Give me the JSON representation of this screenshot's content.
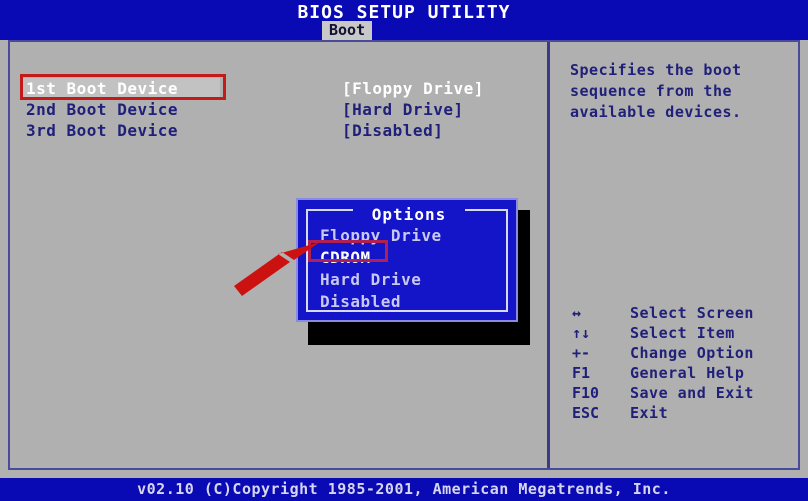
{
  "titlebar": {
    "title": "BIOS SETUP UTILITY",
    "active_tab": "Boot"
  },
  "boot_devices": {
    "rows": [
      {
        "label": "1st Boot Device",
        "value": "[Floppy Drive]",
        "selected": true
      },
      {
        "label": "2nd Boot Device",
        "value": "[Hard Drive]",
        "selected": false
      },
      {
        "label": "3rd Boot Device",
        "value": "[Disabled]",
        "selected": false
      }
    ]
  },
  "options_popup": {
    "title": "Options",
    "items": [
      {
        "label": "Floppy Drive",
        "active": false
      },
      {
        "label": "CDROM",
        "active": true
      },
      {
        "label": "Hard Drive",
        "active": false
      },
      {
        "label": "Disabled",
        "active": false
      }
    ]
  },
  "help": {
    "text": "Specifies the boot sequence from the available devices."
  },
  "key_legend": [
    {
      "symbol": "↔",
      "description": "Select Screen"
    },
    {
      "symbol": "↑↓",
      "description": "Select Item"
    },
    {
      "symbol": "+-",
      "description": "Change Option"
    },
    {
      "symbol": "F1",
      "description": "General Help"
    },
    {
      "symbol": "F10",
      "description": "Save and Exit"
    },
    {
      "symbol": "ESC",
      "description": "Exit"
    }
  ],
  "footer": {
    "text": "v02.10 (C)Copyright 1985-2001, American Megatrends, Inc."
  },
  "annotations": {
    "boot_device_box_color": "#c41a1a",
    "cdrom_box_color": "#b02050",
    "arrow_color": "#cc1111"
  }
}
